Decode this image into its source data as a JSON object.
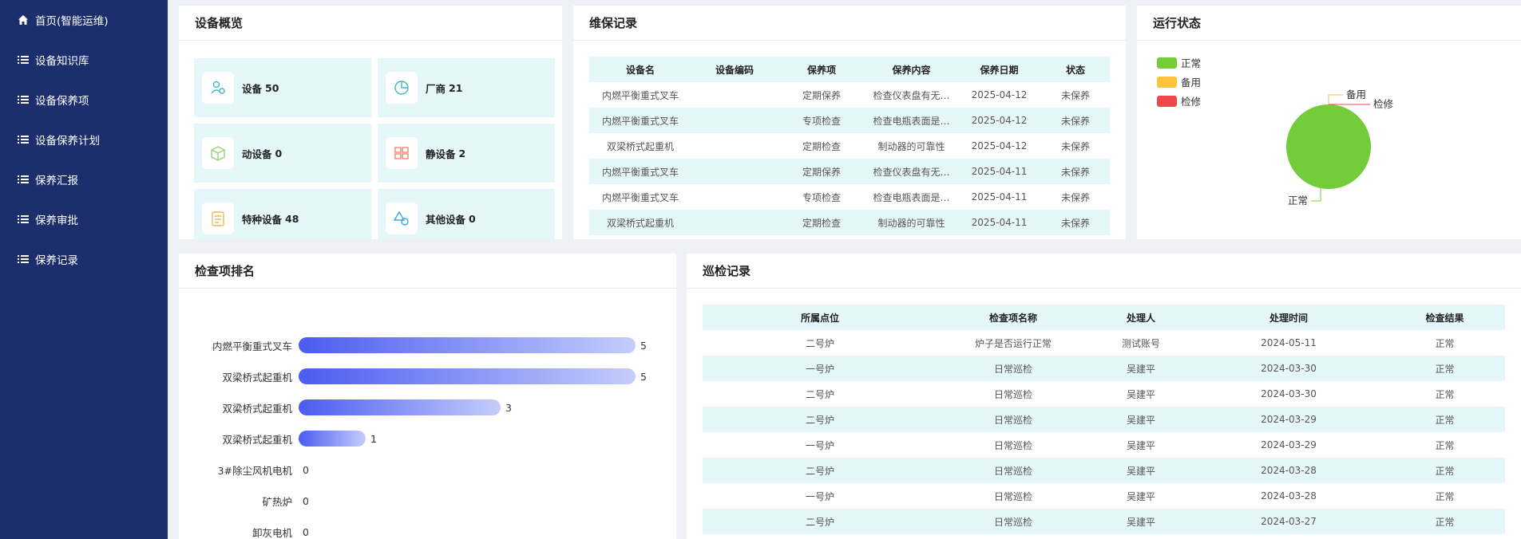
{
  "sidebar": {
    "items": [
      {
        "label": "首页(智能运维)",
        "icon": "home-icon"
      },
      {
        "label": "设备知识库",
        "icon": "list-icon"
      },
      {
        "label": "设备保养项",
        "icon": "list-icon"
      },
      {
        "label": "设备保养计划",
        "icon": "list-icon"
      },
      {
        "label": "保养汇报",
        "icon": "list-icon"
      },
      {
        "label": "保养审批",
        "icon": "list-icon"
      },
      {
        "label": "保养记录",
        "icon": "list-icon"
      }
    ]
  },
  "overview": {
    "title": "设备概览",
    "tiles": [
      {
        "label": "设备",
        "value": "50",
        "icon": "device-user-icon",
        "color": "#3fb8c8"
      },
      {
        "label": "厂商",
        "value": "21",
        "icon": "pie-chart-icon",
        "color": "#3fb8c8"
      },
      {
        "label": "动设备",
        "value": "0",
        "icon": "box-cube-icon",
        "color": "#9bd07a"
      },
      {
        "label": "静设备",
        "value": "2",
        "icon": "static-device-icon",
        "color": "#f08a6c"
      },
      {
        "label": "特种设备",
        "value": "48",
        "icon": "document-icon",
        "color": "#f2b84a"
      },
      {
        "label": "其他设备",
        "value": "0",
        "icon": "shapes-icon",
        "color": "#3fa8e0"
      }
    ]
  },
  "maintenance": {
    "title": "维保记录",
    "columns": [
      "设备名",
      "设备编码",
      "保养项",
      "保养内容",
      "保养日期",
      "状态"
    ],
    "rows": [
      [
        "内燃平衡重式叉车",
        "",
        "定期保养",
        "检查仪表盘有无…",
        "2025-04-12",
        "未保养"
      ],
      [
        "内燃平衡重式叉车",
        "",
        "专项检查",
        "检查电瓶表面是…",
        "2025-04-12",
        "未保养"
      ],
      [
        "双梁桥式起重机",
        "",
        "定期检查",
        "制动器的可靠性",
        "2025-04-12",
        "未保养"
      ],
      [
        "内燃平衡重式叉车",
        "",
        "定期保养",
        "检查仪表盘有无…",
        "2025-04-11",
        "未保养"
      ],
      [
        "内燃平衡重式叉车",
        "",
        "专项检查",
        "检查电瓶表面是…",
        "2025-04-11",
        "未保养"
      ],
      [
        "双梁桥式起重机",
        "",
        "定期检查",
        "制动器的可靠性",
        "2025-04-11",
        "未保养"
      ]
    ]
  },
  "status": {
    "title": "运行状态",
    "legend": [
      {
        "label": "正常",
        "color": "#73cd3b"
      },
      {
        "label": "备用",
        "color": "#fdc33c"
      },
      {
        "label": "检修",
        "color": "#f2464d"
      }
    ],
    "chart_data": {
      "type": "pie",
      "categories": [
        "正常",
        "备用",
        "检修"
      ],
      "values": [
        1,
        0,
        0
      ],
      "colors": [
        "#73cd3b",
        "#fdc33c",
        "#f2464d"
      ],
      "legend_position": "top-left"
    }
  },
  "ranking": {
    "title": "检查项排名",
    "chart_data": {
      "type": "bar",
      "orientation": "horizontal",
      "categories": [
        "内燃平衡重式叉车",
        "双梁桥式起重机",
        "双梁桥式起重机",
        "双梁桥式起重机",
        "3#除尘风机电机",
        "矿热炉",
        "卸灰电机"
      ],
      "values": [
        5,
        5,
        3,
        1,
        0,
        0,
        0
      ],
      "xlim": [
        0,
        5
      ],
      "grid": false
    }
  },
  "inspection": {
    "title": "巡检记录",
    "columns": [
      "所属点位",
      "检查项名称",
      "处理人",
      "处理时间",
      "检查结果"
    ],
    "rows": [
      [
        "二号炉",
        "炉子是否运行正常",
        "测试账号",
        "2024-05-11",
        "正常"
      ],
      [
        "一号炉",
        "日常巡检",
        "吴建平",
        "2024-03-30",
        "正常"
      ],
      [
        "二号炉",
        "日常巡检",
        "吴建平",
        "2024-03-30",
        "正常"
      ],
      [
        "二号炉",
        "日常巡检",
        "吴建平",
        "2024-03-29",
        "正常"
      ],
      [
        "一号炉",
        "日常巡检",
        "吴建平",
        "2024-03-29",
        "正常"
      ],
      [
        "二号炉",
        "日常巡检",
        "吴建平",
        "2024-03-28",
        "正常"
      ],
      [
        "一号炉",
        "日常巡检",
        "吴建平",
        "2024-03-28",
        "正常"
      ],
      [
        "二号炉",
        "日常巡检",
        "吴建平",
        "2024-03-27",
        "正常"
      ]
    ]
  }
}
